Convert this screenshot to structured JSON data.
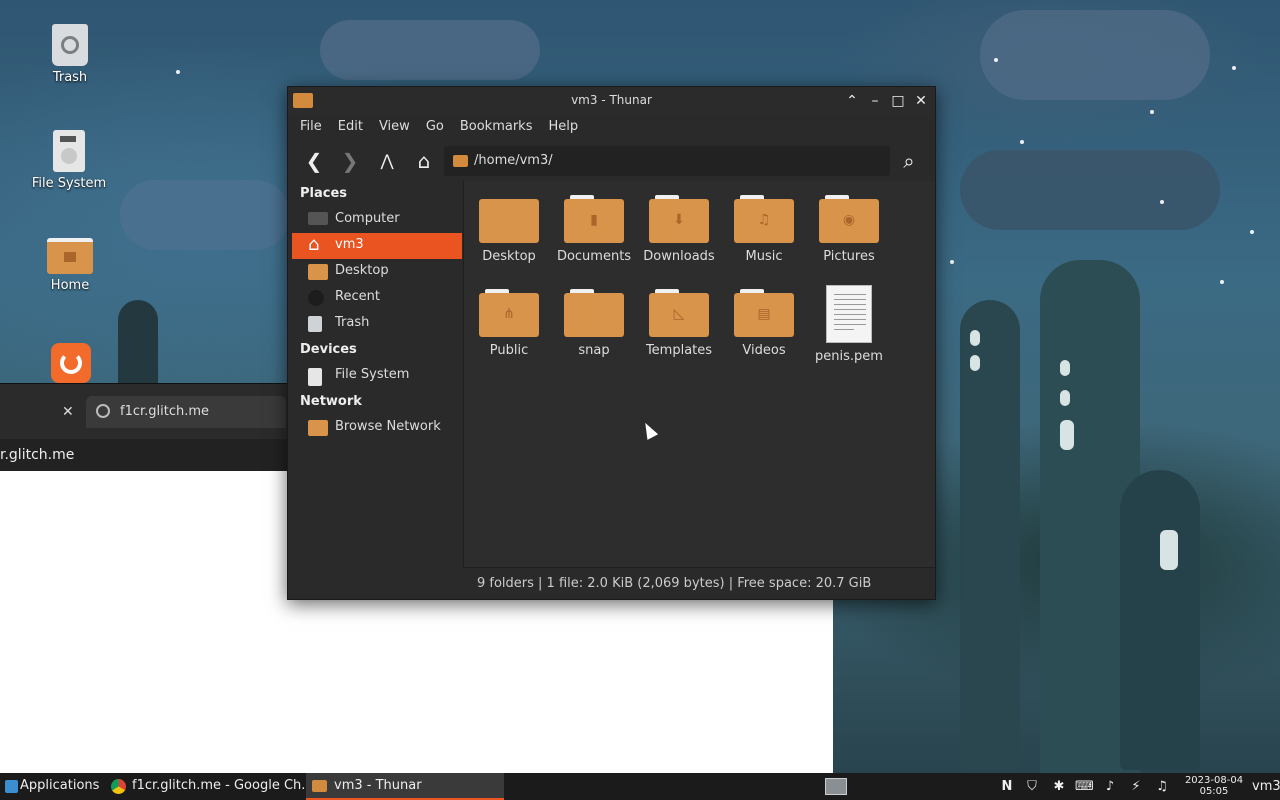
{
  "desktop": {
    "icons": [
      {
        "label": "Trash"
      },
      {
        "label": "File System"
      },
      {
        "label": "Home"
      }
    ]
  },
  "browser": {
    "tab_label": "f1cr.glitch.me",
    "url_text": "r.glitch.me"
  },
  "thunar": {
    "title": "vm3 - Thunar",
    "menu": [
      "File",
      "Edit",
      "View",
      "Go",
      "Bookmarks",
      "Help"
    ],
    "path": "/home/vm3/",
    "sidebar": {
      "places_heading": "Places",
      "places": [
        "Computer",
        "vm3",
        "Desktop",
        "Recent",
        "Trash"
      ],
      "devices_heading": "Devices",
      "devices": [
        "File System"
      ],
      "network_heading": "Network",
      "network": [
        "Browse Network"
      ]
    },
    "files": [
      {
        "name": "Desktop",
        "icon": "folder-desktop-icon"
      },
      {
        "name": "Documents",
        "icon": "folder-documents-icon"
      },
      {
        "name": "Downloads",
        "icon": "folder-downloads-icon"
      },
      {
        "name": "Music",
        "icon": "folder-music-icon"
      },
      {
        "name": "Pictures",
        "icon": "folder-pictures-icon"
      },
      {
        "name": "Public",
        "icon": "folder-public-icon"
      },
      {
        "name": "snap",
        "icon": "folder-icon"
      },
      {
        "name": "Templates",
        "icon": "folder-templates-icon"
      },
      {
        "name": "Videos",
        "icon": "folder-videos-icon"
      },
      {
        "name": "penis.pem",
        "icon": "text-document-icon"
      }
    ],
    "status": "9 folders  |  1 file: 2.0 KiB (2,069 bytes)  |  Free space: 20.7 GiB"
  },
  "taskbar": {
    "applications_label": "Applications",
    "tasks": [
      "f1cr.glitch.me - Google Ch...",
      "vm3 - Thunar"
    ],
    "clock_date": "2023-08-04",
    "clock_time": "05:05",
    "user": "vm3"
  },
  "colors": {
    "accent": "#e95420",
    "folder": "#d9944b",
    "window_bg": "#2a2a2a"
  }
}
